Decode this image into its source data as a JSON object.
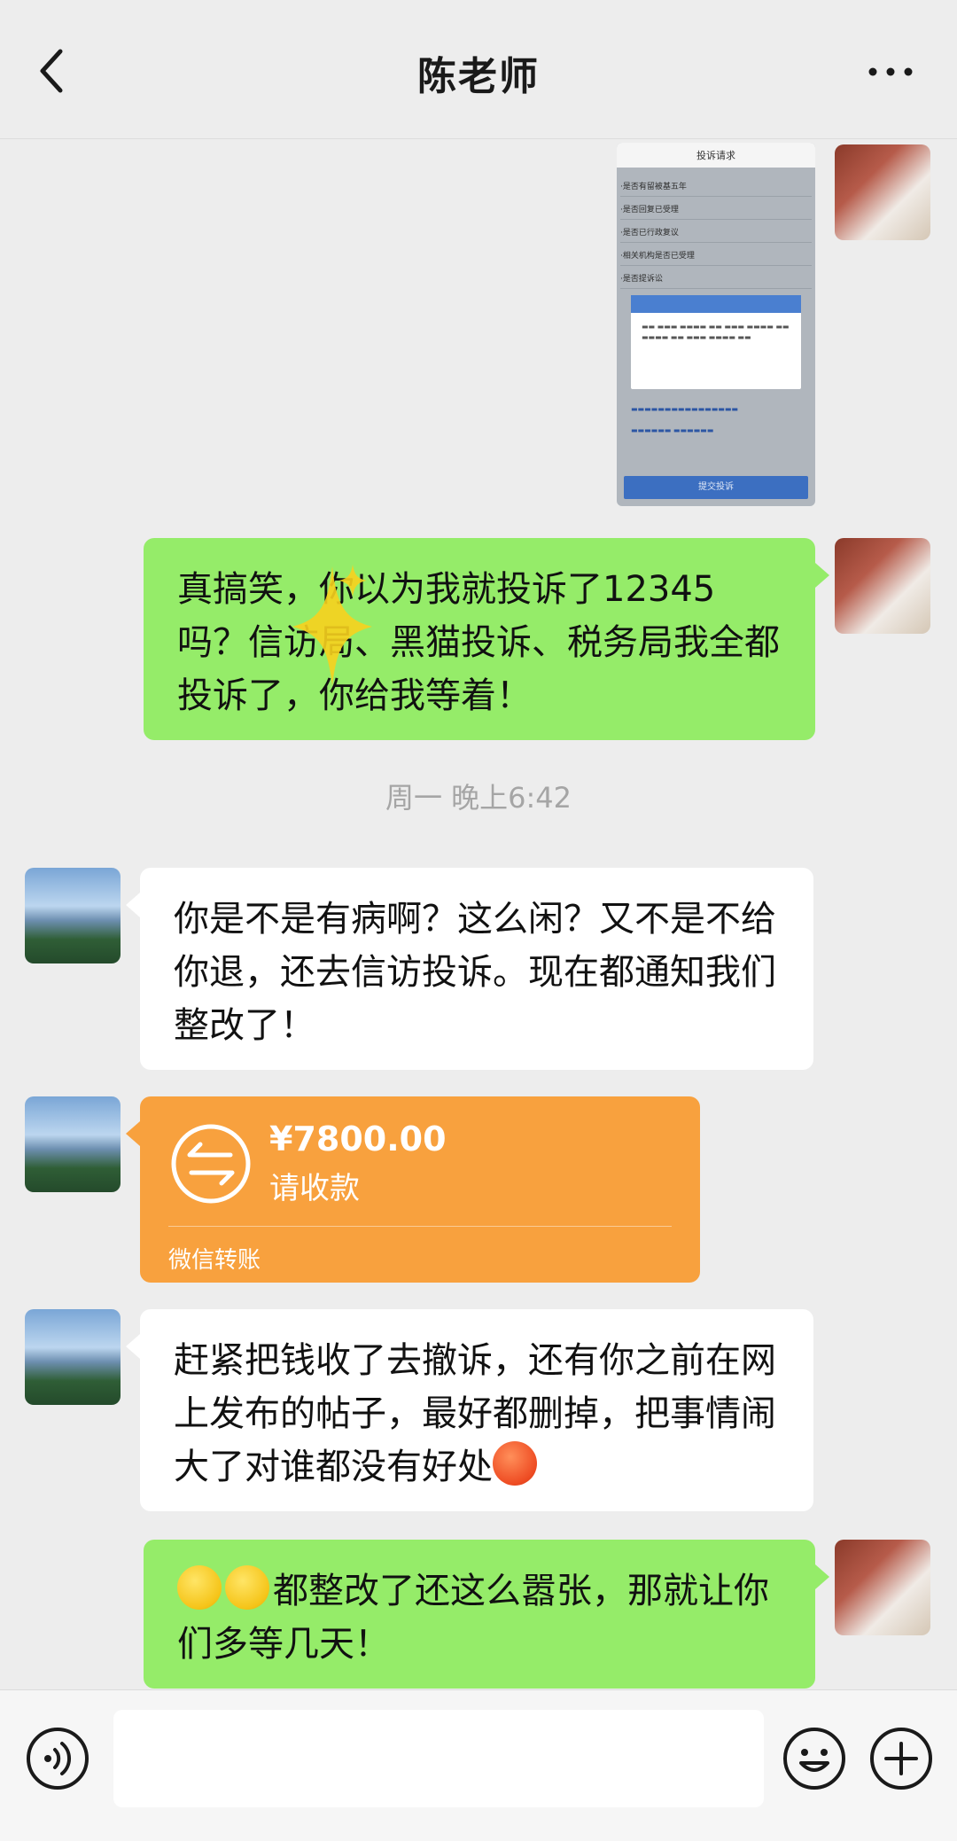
{
  "header": {
    "title": "陈老师",
    "back_icon": "chevron-left-icon",
    "more_icon": "ellipsis-icon"
  },
  "messages": {
    "m1_image": {
      "sender": "me",
      "type": "image",
      "ss_title": "投诉请求",
      "ss_rows": [
        "·是否有留被基五年",
        "·是否回复已受理",
        "·是否已行政复议",
        "·相关机构是否已受理",
        "·是否提诉讼"
      ],
      "ss_submit": "提交投诉"
    },
    "m2": {
      "sender": "me",
      "text": "真搞笑，你以为我就投诉了12345吗？信访局、黑猫投诉、税务局我全都投诉了，你给我等着！"
    },
    "timestamp": "周一 晚上6:42",
    "m3": {
      "sender": "other",
      "text": "你是不是有病啊？这么闲？又不是不给你退，还去信访投诉。现在都通知我们整改了！"
    },
    "m4_transfer": {
      "sender": "other",
      "amount": "¥7800.00",
      "label": "请收款",
      "source": "微信转账"
    },
    "m5": {
      "sender": "other",
      "text": "赶紧把钱收了去撤诉，还有你之前在网上发布的帖子，最好都删掉，把事情闹大了对谁都没有好处"
    },
    "m6": {
      "sender": "me",
      "text": "都整改了还这么嚣张，那就让你们多等几天！"
    }
  },
  "colors": {
    "my_bubble": "#95ec69",
    "other_bubble": "#ffffff",
    "transfer": "#f8a13e",
    "background": "#ededed"
  },
  "bottom_bar": {
    "voice_icon": "voice-icon",
    "emoji_icon": "emoji-icon",
    "plus_icon": "plus-icon"
  }
}
